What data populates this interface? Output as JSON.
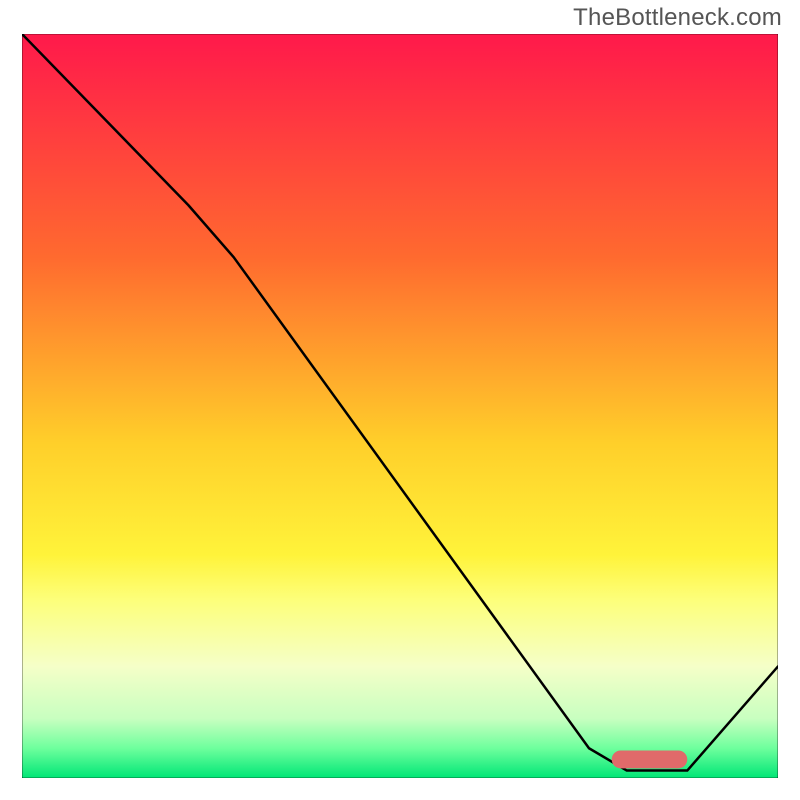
{
  "watermark": "TheBottleneck.com",
  "chart_data": {
    "type": "line",
    "title": "",
    "xlabel": "",
    "ylabel": "",
    "xlim": [
      0,
      100
    ],
    "ylim": [
      0,
      100
    ],
    "gradient_stops": [
      {
        "offset": 0,
        "color": "#ff194b"
      },
      {
        "offset": 30,
        "color": "#ff6a2f"
      },
      {
        "offset": 55,
        "color": "#ffcf2a"
      },
      {
        "offset": 70,
        "color": "#fff33a"
      },
      {
        "offset": 76,
        "color": "#fdff7a"
      },
      {
        "offset": 85,
        "color": "#f5ffc8"
      },
      {
        "offset": 92,
        "color": "#c8ffc0"
      },
      {
        "offset": 96,
        "color": "#6eff9d"
      },
      {
        "offset": 100,
        "color": "#00e676"
      }
    ],
    "curve": [
      {
        "x": 0,
        "y": 100
      },
      {
        "x": 22,
        "y": 77
      },
      {
        "x": 28,
        "y": 70
      },
      {
        "x": 75,
        "y": 4
      },
      {
        "x": 80,
        "y": 1
      },
      {
        "x": 88,
        "y": 1
      },
      {
        "x": 100,
        "y": 15
      }
    ],
    "marker": {
      "x0": 78,
      "x1": 88,
      "y": 2.5,
      "color": "#e06a6a"
    },
    "border_color": "#000000"
  }
}
